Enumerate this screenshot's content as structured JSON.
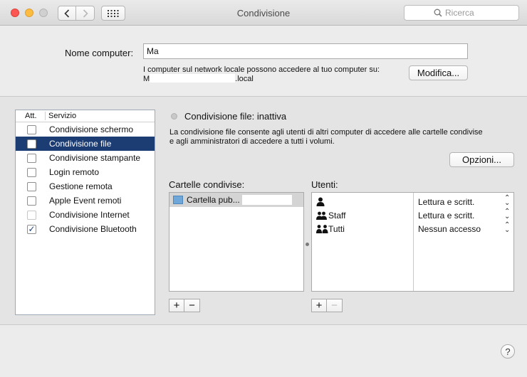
{
  "window": {
    "title": "Condivisione"
  },
  "search": {
    "placeholder": "Ricerca"
  },
  "computer_name": {
    "label": "Nome computer:",
    "value": "Ma",
    "hint_line1": "I computer sul network locale possono accedere al tuo computer su:",
    "hint_line2_prefix": "M",
    "hint_line2_suffix": ".local",
    "edit_button": "Modifica..."
  },
  "services": {
    "header_att": "Att.",
    "header_service": "Servizio",
    "items": [
      {
        "label": "Condivisione schermo",
        "checked": false,
        "selected": false,
        "disabled": false
      },
      {
        "label": "Condivisione file",
        "checked": false,
        "selected": true,
        "disabled": false
      },
      {
        "label": "Condivisione stampante",
        "checked": false,
        "selected": false,
        "disabled": false
      },
      {
        "label": "Login remoto",
        "checked": false,
        "selected": false,
        "disabled": false
      },
      {
        "label": "Gestione remota",
        "checked": false,
        "selected": false,
        "disabled": false
      },
      {
        "label": "Apple Event remoti",
        "checked": false,
        "selected": false,
        "disabled": false
      },
      {
        "label": "Condivisione Internet",
        "checked": false,
        "selected": false,
        "disabled": true
      },
      {
        "label": "Condivisione Bluetooth",
        "checked": true,
        "selected": false,
        "disabled": false
      }
    ]
  },
  "detail": {
    "status_title": "Condivisione file: inattiva",
    "description": "La condivisione file consente agli utenti di altri computer di accedere alle cartelle condivise e agli amministratori di accedere a tutti i volumi.",
    "options_button": "Opzioni...",
    "shared_folders_label": "Cartelle condivise:",
    "shared_folders": [
      "Cartella pub..."
    ],
    "users_label": "Utenti:",
    "users": [
      {
        "name": "",
        "permission": "Lettura e scritt."
      },
      {
        "name": "Staff",
        "permission": "Lettura e scritt."
      },
      {
        "name": "Tutti",
        "permission": "Nessun accesso"
      }
    ]
  },
  "controls": {
    "plus": "+",
    "minus": "−",
    "help": "?"
  },
  "colors": {
    "selection": "#1c3d73",
    "close": "#fc5753",
    "minimize": "#fdbc40"
  }
}
